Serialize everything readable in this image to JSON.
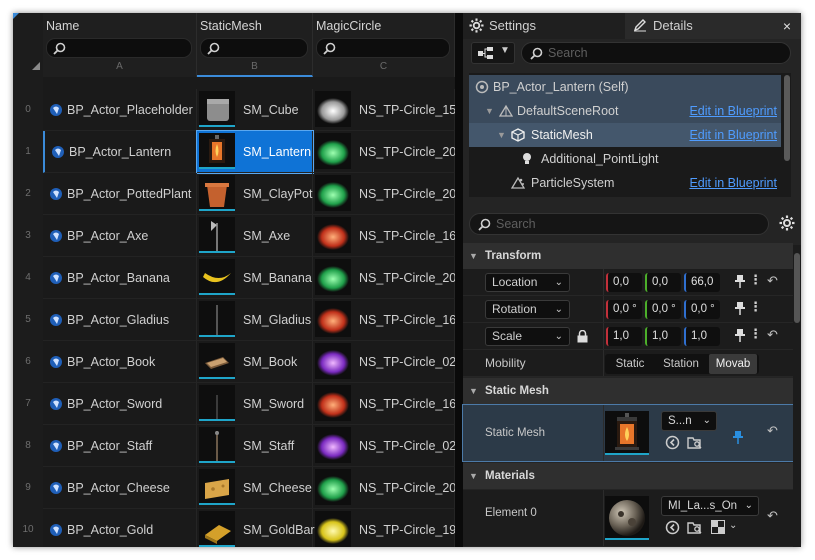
{
  "sheet": {
    "columns": [
      {
        "name": "Name",
        "letter": "A"
      },
      {
        "name": "StaticMesh",
        "letter": "B"
      },
      {
        "name": "MagicCircle",
        "letter": "C"
      }
    ],
    "rows": [
      {
        "num": "0",
        "name": "BP_Actor_Placeholder",
        "mesh": "SM_Cube",
        "circle": "NS_TP-Circle_15",
        "thumb": "cube",
        "fx": "white"
      },
      {
        "num": "1",
        "name": "BP_Actor_Lantern",
        "mesh": "SM_Lantern",
        "circle": "NS_TP-Circle_20",
        "thumb": "lantern",
        "fx": "green"
      },
      {
        "num": "2",
        "name": "BP_Actor_PottedPlant",
        "mesh": "SM_ClayPot",
        "circle": "NS_TP-Circle_20",
        "thumb": "pot",
        "fx": "green"
      },
      {
        "num": "3",
        "name": "BP_Actor_Axe",
        "mesh": "SM_Axe",
        "circle": "NS_TP-Circle_16",
        "thumb": "axe",
        "fx": "red"
      },
      {
        "num": "4",
        "name": "BP_Actor_Banana",
        "mesh": "SM_Banana",
        "circle": "NS_TP-Circle_20",
        "thumb": "banana",
        "fx": "green"
      },
      {
        "num": "5",
        "name": "BP_Actor_Gladius",
        "mesh": "SM_Gladius",
        "circle": "NS_TP-Circle_16",
        "thumb": "sword",
        "fx": "red"
      },
      {
        "num": "6",
        "name": "BP_Actor_Book",
        "mesh": "SM_Book",
        "circle": "NS_TP-Circle_02",
        "thumb": "book",
        "fx": "purple"
      },
      {
        "num": "7",
        "name": "BP_Actor_Sword",
        "mesh": "SM_Sword",
        "circle": "NS_TP-Circle_16",
        "thumb": "sword2",
        "fx": "red"
      },
      {
        "num": "8",
        "name": "BP_Actor_Staff",
        "mesh": "SM_Staff",
        "circle": "NS_TP-Circle_02",
        "thumb": "staff",
        "fx": "purple"
      },
      {
        "num": "9",
        "name": "BP_Actor_Cheese",
        "mesh": "SM_Cheese",
        "circle": "NS_TP-Circle_20",
        "thumb": "cheese",
        "fx": "green"
      },
      {
        "num": "10",
        "name": "BP_Actor_Gold",
        "mesh": "SM_GoldBar",
        "circle": "NS_TP-Circle_19",
        "thumb": "gold",
        "fx": "yellow"
      }
    ]
  },
  "tabs": {
    "settings": "Settings",
    "details": "Details",
    "close": "×"
  },
  "toolbar": {
    "search_placeholder": "Search"
  },
  "tree": {
    "root": "BP_Actor_Lantern (Self)",
    "edit_label": "Edit in Blueprint",
    "items": [
      {
        "label": "DefaultSceneRoot"
      },
      {
        "label": "StaticMesh"
      },
      {
        "label": "Additional_PointLight"
      },
      {
        "label": "ParticleSystem"
      }
    ]
  },
  "details": {
    "search_placeholder": "Search",
    "transform": {
      "title": "Transform",
      "location": {
        "label": "Location",
        "x": "0,0",
        "y": "0,0",
        "z": "66,0"
      },
      "rotation": {
        "label": "Rotation",
        "x": "0,0 °",
        "y": "0,0 °",
        "z": "0,0 °"
      },
      "scale": {
        "label": "Scale",
        "x": "1,0",
        "y": "1,0",
        "z": "1,0"
      },
      "mobility": {
        "label": "Mobility",
        "options": [
          "Static",
          "Station",
          "Movab"
        ],
        "selected": "Movab"
      }
    },
    "static_mesh": {
      "title": "Static Mesh",
      "label": "Static Mesh",
      "value": "S...n"
    },
    "materials": {
      "title": "Materials",
      "label": "Element 0",
      "value": "MI_La...s_On"
    }
  },
  "colors": {
    "accent": "#3b8bd9",
    "link": "#4f9cff",
    "selected_cell": "#0f73d6"
  }
}
